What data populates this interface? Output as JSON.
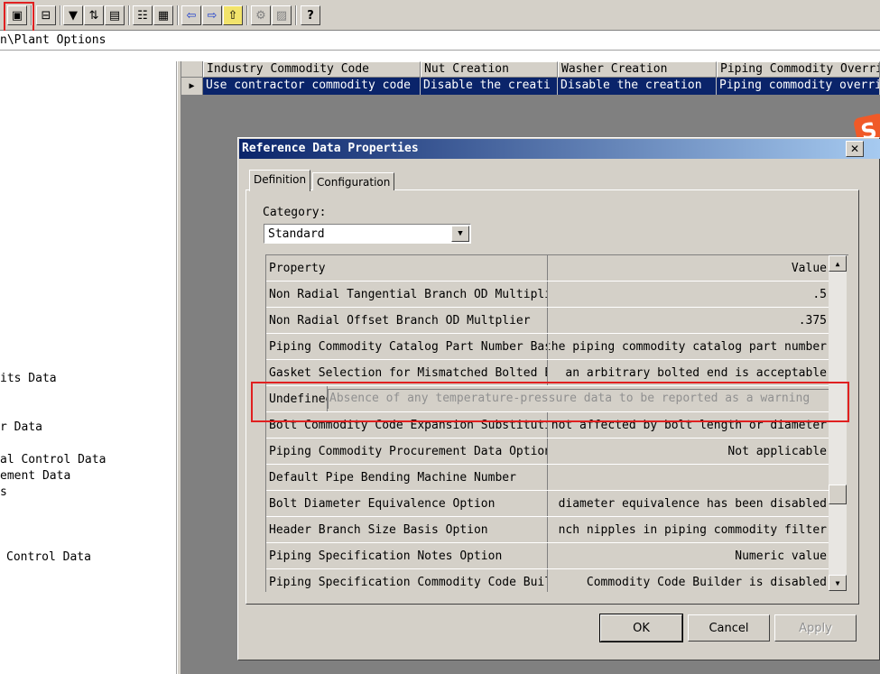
{
  "toolbar": {
    "buttons": [
      {
        "icon": "properties-icon",
        "glyph": "▣"
      },
      {
        "icon": "new-row-icon",
        "glyph": "⊟"
      },
      {
        "icon": "filter-icon",
        "glyph": "▼"
      },
      {
        "icon": "sort-icon",
        "glyph": "⇅"
      },
      {
        "icon": "form-icon",
        "glyph": "▤"
      },
      {
        "icon": "list-view-icon",
        "glyph": "☷"
      },
      {
        "icon": "grid-view-icon",
        "glyph": "▦"
      },
      {
        "icon": "back-arrow-icon",
        "glyph": "⇦"
      },
      {
        "icon": "forward-arrow-icon",
        "glyph": "⇨"
      },
      {
        "icon": "up-folder-icon",
        "glyph": "⇧"
      },
      {
        "icon": "tool-a-icon",
        "glyph": "⚙"
      },
      {
        "icon": "tool-b-icon",
        "glyph": "▨"
      },
      {
        "icon": "help-icon",
        "glyph": "?"
      }
    ]
  },
  "path_text": "n\\Plant Options",
  "tree": {
    "items": [
      "its Data",
      "r Data",
      "al Control Data",
      "ement Data",
      "s",
      "Control Data"
    ]
  },
  "grid": {
    "columns": [
      "Industry Commodity Code",
      "Nut Creation",
      "Washer Creation",
      "Piping Commodity Overri"
    ],
    "row": [
      "Use contractor commodity code",
      "Disable the creati",
      "Disable the creation",
      "Piping commodity overri"
    ],
    "row_marker": "▶"
  },
  "logo_text": "S",
  "dialog": {
    "title": "Reference Data Properties",
    "close_glyph": "✕",
    "tabs": [
      "Definition",
      "Configuration"
    ],
    "category_label": "Category:",
    "category_value": "Standard",
    "dropdown_glyph": "▼",
    "header": {
      "property": "Property",
      "value": "Value"
    },
    "rows": [
      {
        "name": "Non Radial Tangential Branch OD Multiplier",
        "value": ".5"
      },
      {
        "name": "Non Radial Offset Branch OD Multplier",
        "value": ".375"
      },
      {
        "name": "Piping Commodity Catalog Part Number Basis",
        "value": "the piping commodity catalog part number"
      },
      {
        "name": "Gasket Selection for Mismatched Bolted Ends",
        "value": "an arbitrary bolted end is acceptable"
      },
      {
        "name": "Undefined",
        "value": "Absence of any temperature-pressure data to be reported as a warning"
      },
      {
        "name": "Bolt Commodity Code Expansion Substitution",
        "value": "not affected by bolt length or diameter"
      },
      {
        "name": "Piping Commodity Procurement Data Option",
        "value": "Not applicable"
      },
      {
        "name": "Default Pipe Bending Machine Number",
        "value": ""
      },
      {
        "name": "Bolt Diameter Equivalence Option",
        "value": "diameter equivalence has been disabled"
      },
      {
        "name": "Header Branch Size Basis Option",
        "value": "nch nipples in piping commodity filter"
      },
      {
        "name": "Piping Specification Notes Option",
        "value": "Numeric value"
      },
      {
        "name": "Piping Specification Commodity Code Builder",
        "value": "Commodity Code Builder is disabled"
      }
    ],
    "scroll_up": "▲",
    "scroll_down": "▼",
    "buttons": {
      "ok": "OK",
      "cancel": "Cancel",
      "apply": "Apply"
    }
  },
  "colors": {
    "selection": "#0a246a",
    "highlight_box": "#e02020",
    "face": "#d4d0c8"
  }
}
